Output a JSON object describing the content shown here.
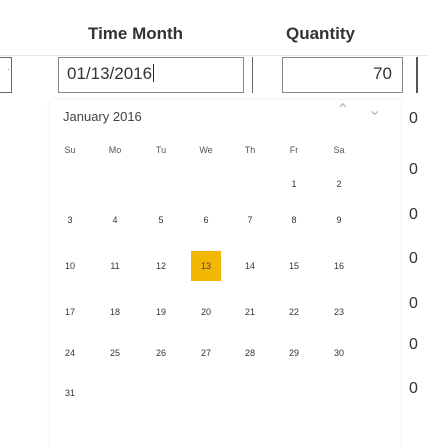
{
  "headers": {
    "time_month": "Time Month",
    "quantity": "Quantity"
  },
  "row": {
    "date_value": "01/13/2016",
    "quantity_value": "70"
  },
  "calendar": {
    "title": "January 2016",
    "weekdays": [
      "Su",
      "Mo",
      "Tu",
      "We",
      "Th",
      "Fr",
      "Sa"
    ],
    "weeks": [
      [
        "",
        "",
        "",
        "",
        "",
        "1",
        "2"
      ],
      [
        "3",
        "4",
        "5",
        "6",
        "7",
        "8",
        "9"
      ],
      [
        "10",
        "11",
        "12",
        "13",
        "14",
        "15",
        "16"
      ],
      [
        "17",
        "18",
        "19",
        "20",
        "21",
        "22",
        "23"
      ],
      [
        "24",
        "25",
        "26",
        "27",
        "28",
        "29",
        "30"
      ],
      [
        "31",
        "",
        "",
        "",
        "",
        "",
        ""
      ]
    ],
    "selected_day": "13",
    "selected_color": "#f2b705"
  },
  "quantity_column": [
    "0",
    "0",
    "0",
    "0",
    "0",
    "0",
    "0"
  ],
  "icons": {
    "prev": "chevron-up-icon",
    "next": "chevron-down-icon"
  }
}
